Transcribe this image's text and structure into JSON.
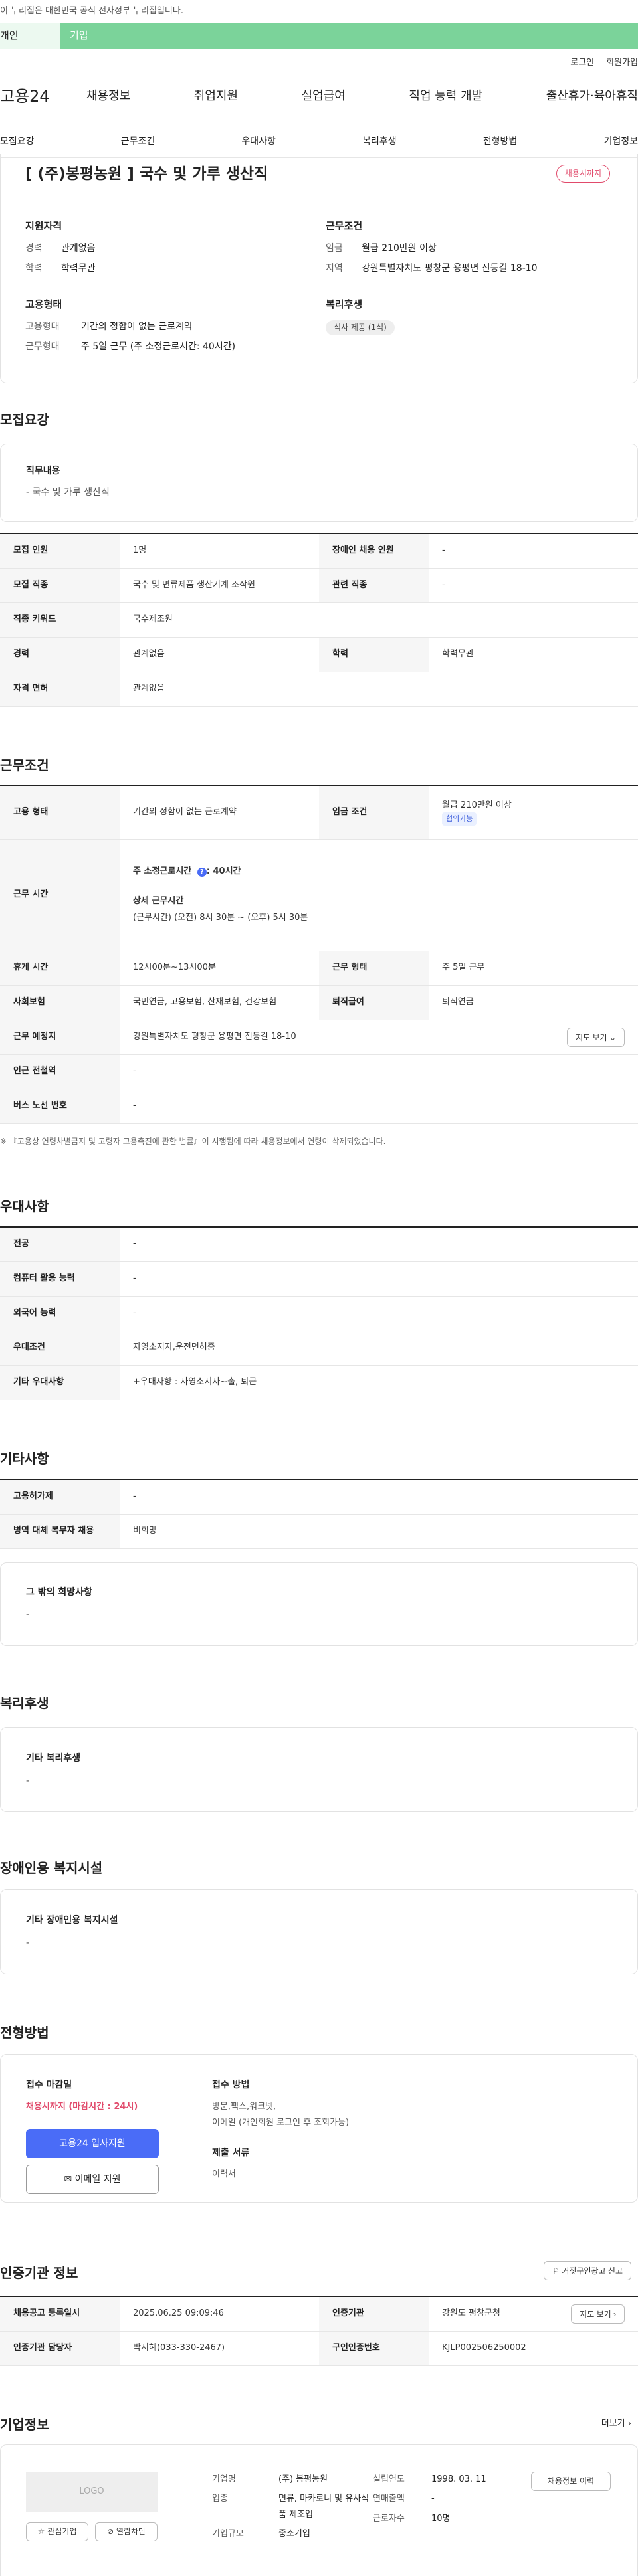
{
  "notice": "이 누리집은 대한민국 공식 전자정부 누리집입니다.",
  "tabs": [
    "개인",
    "기업"
  ],
  "util": [
    "로그인",
    "회원가입"
  ],
  "logo": "고용24",
  "gnb": [
    "채용정보",
    "취업지원",
    "실업급여",
    "직업 능력 개발",
    "출산휴가·육아휴직"
  ],
  "snb": [
    "모집요강",
    "근무조건",
    "우대사항",
    "복리후생",
    "전형방법",
    "기업정보"
  ],
  "job": {
    "title": "[ (주)봉평농원 ] 국수 및 가루 생산직",
    "badge": "채용시까지"
  },
  "summary": {
    "qual_label": "지원자격",
    "career_k": "경력",
    "career_v": "관계없음",
    "edu_k": "학력",
    "edu_v": "학력무관",
    "cond_label": "근무조건",
    "wage_k": "임금",
    "wage_v": "월급 210만원 이상",
    "area_k": "지역",
    "area_v": "강원특별자치도 평창군 용평면 진등길 18-10",
    "type_label": "고용형태",
    "type_k": "고용형태",
    "type_v": "기간의 정함이 없는 근로계약",
    "hour_k": "근무형태",
    "hour_v": "주 5일 근무 (주 소정근로시간: 40시간)",
    "welfare_label": "복리후생",
    "welfare_chip": "식사 제공 (1식)"
  },
  "recruit": {
    "section": "모집요강",
    "duty_label": "직무내용",
    "duty": "- 국수 및 가루 생산직",
    "r1": [
      "모집 인원",
      "1명",
      "장애인 채용 인원",
      "-"
    ],
    "r2": [
      "모집 직종",
      "국수 및 면류제품 생산기계 조작원",
      "관련 직종",
      "-"
    ],
    "r3": [
      "직종 키워드",
      "국수제조원"
    ],
    "r4": [
      "경력",
      "관계없음",
      "학력",
      "학력무관"
    ],
    "r5": [
      "자격 면허",
      "관계없음"
    ]
  },
  "work": {
    "section": "근무조건",
    "w1": [
      "고용 형태",
      "기간의 정함이 없는 근로계약",
      "임금 조건",
      "월급 210만원 이상",
      "협의가능"
    ],
    "w2_k": "근무 시간",
    "w2_a": "주 소정근로시간 ",
    "w2_b": ": 40시간",
    "w2_c": "상세 근무시간",
    "w2_d": "(근무시간) (오전) 8시 30분 ~ (오후) 5시 30분",
    "w3": [
      "휴게 시간",
      "12시00분~13시00분",
      "근무 형태",
      "주 5일 근무"
    ],
    "w4": [
      "사회보험",
      "국민연금, 고용보험, 산재보험, 건강보험",
      "퇴직급여",
      "퇴직연금"
    ],
    "w5": [
      "근무 예정지",
      "강원특별자치도 평창군 용평면 진등길 18-10",
      "지도 보기"
    ],
    "w6": [
      "인근 전철역",
      "-"
    ],
    "w7": [
      "버스 노선 번호",
      "-"
    ],
    "note": "※ 『고용상 연령차별금지 및 고령자 고용촉진에 관한 법률』이 시행됨에 따라 채용정보에서 연령이 삭제되었습니다."
  },
  "pref": {
    "section": "우대사항",
    "p1": [
      "전공",
      "-"
    ],
    "p2": [
      "컴퓨터 활용 능력",
      "-"
    ],
    "p3": [
      "외국어 능력",
      "-"
    ],
    "p4": [
      "우대조건",
      "자영소지자,운전면허증"
    ],
    "p5": [
      "기타 우대사항",
      "+우대사항 : 자영소지자~출, 퇴근"
    ]
  },
  "etc": {
    "section": "기타사항",
    "e1": [
      "고용허가제",
      "-"
    ],
    "e2": [
      "병역 대체 복무자 채용",
      "비희망"
    ],
    "wish_label": "그 밖의 희망사항",
    "wish": "-"
  },
  "welfare": {
    "section": "복리후생",
    "label": "기타 복리후생",
    "value": "-"
  },
  "disabled": {
    "section": "장애인용 복지시설",
    "label": "기타 장애인용 복지시설",
    "value": "-"
  },
  "process": {
    "section": "전형방법",
    "deadline_label": "접수 마감일",
    "deadline": "채용시까지 (마감시간 : 24시)",
    "apply_btn": "고용24 입사지원",
    "email_btn": "이메일 지원",
    "method_label": "접수 방법",
    "method": "방문,팩스,워크넷,",
    "method2": "이메일 (개인회원 로그인 후 조회가능)",
    "docs_label": "제출 서류",
    "docs": "이력서"
  },
  "agency": {
    "section": "인증기관 정보",
    "report_btn": "거짓구인광고 신고",
    "a1": [
      "채용공고 등록일시",
      "2025.06.25 09:09:46",
      "인증기관",
      "강원도 평창군청",
      "지도 보기"
    ],
    "a2": [
      "인증기관 담당자",
      "박지혜(033-330-2467)",
      "구인인증번호",
      "KJLP002506250002"
    ]
  },
  "company": {
    "section": "기업정보",
    "more": "더보기",
    "logo": "LOGO",
    "fav": "관심기업",
    "block": "열람차단",
    "name_k": "기업명",
    "name_v": "(주) 봉평농원",
    "year_k": "설립연도",
    "year_v": "1998. 03. 11",
    "biz_k": "업종",
    "biz_v": "면류, 마카로니 및 유사식품 제조업",
    "sales_k": "연매출액",
    "sales_v": "-",
    "emp_k": "근로자수",
    "emp_v": "10명",
    "size_k": "기업규모",
    "size_v": "중소기업",
    "history_btn": "채용정보 이력"
  }
}
